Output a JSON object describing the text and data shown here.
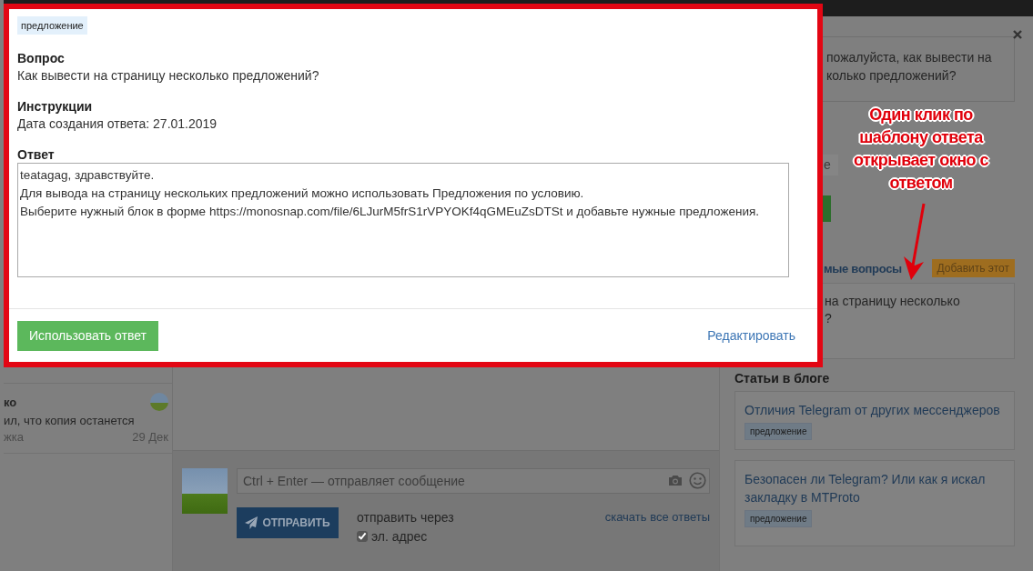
{
  "chat_list": {
    "items": [
      {
        "name": "ко",
        "preview": "ил, что копия останется",
        "status": "жка",
        "date": "29 Дек"
      }
    ]
  },
  "composer": {
    "placeholder": "Ctrl + Enter — отправляет сообщение",
    "send_button": "ОТПРАВИТЬ",
    "send_via_label": "отправить через",
    "channels": [
      {
        "label": "эл. адрес",
        "checked": true
      }
    ],
    "download_link": "скачать все ответы"
  },
  "sidebar": {
    "question_lines": [
      "пожалуйста, как вывести на",
      "колько предложений?"
    ],
    "select_value": "е",
    "faq_heading": "мые вопросы",
    "add_button": "Добавить этот",
    "faq_items": [
      {
        "lines": [
          "на страницу несколько",
          "?"
        ]
      }
    ],
    "blog_heading": "Статьи в блоге",
    "blog_posts": [
      {
        "title": "Отличия Telegram от других мессенджеров",
        "tag": "предложение"
      },
      {
        "title": "Безопасен ли Telegram? Или как я искал закладку в MTProto",
        "tag": "предложение"
      }
    ]
  },
  "dialog": {
    "tag": "предложение",
    "sections": [
      {
        "heading": "Вопрос",
        "text": "Как вывести на страницу несколько предложений?"
      },
      {
        "heading": "Инструкции",
        "text": "Дата создания ответа: 27.01.2019"
      }
    ],
    "answer_heading": "Ответ",
    "answer_lines": [
      "teatagag, здравствуйте.",
      "Для вывода на страницу нескольких предложений можно использовать Предложения по условию.",
      "Выберите нужный блок в форме https://monosnap.com/file/6LJurM5frS1rVPYOKf4qGMEuZsDTSt и добавьте нужные предложения."
    ],
    "use_button": "Использовать ответ",
    "edit_link": "Редактировать"
  },
  "annotation": {
    "text": "Один клик по шаблону ответа открывает окно с ответом"
  }
}
